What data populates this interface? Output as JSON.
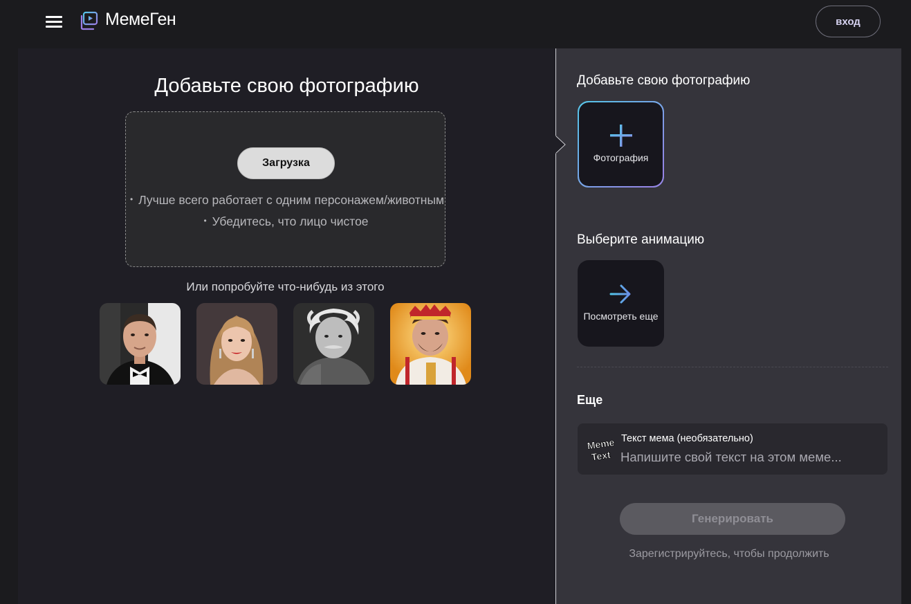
{
  "header": {
    "logo_text": "МемеГен",
    "login_label": "вход"
  },
  "main": {
    "title": "Добавьте свою фотографию",
    "upload_label": "Загрузка",
    "tips": [
      "Лучше всего работает с одним персонажем/животным",
      "Убедитесь, что лицо чистое"
    ],
    "try_label": "Или попробуйте что-нибудь из этого",
    "samples": [
      {
        "name": "sample-man-tuxedo"
      },
      {
        "name": "sample-woman-blonde"
      },
      {
        "name": "sample-old-man-bw"
      },
      {
        "name": "sample-saint-icon"
      }
    ]
  },
  "panel": {
    "photo_section_title": "Добавьте свою фотографию",
    "photo_tile_label": "Фотография",
    "animation_section_title": "Выберите анимацию",
    "animation_tile_label": "Посмотреть еще",
    "more_title": "Еще",
    "meme_text_label": "Текст мема (необязательно)",
    "meme_text_placeholder": "Напишите свой текст на этом меме...",
    "meme_icon_text_1": "Meme",
    "meme_icon_text_2": "Text",
    "generate_label": "Генерировать",
    "signup_hint": "Зарегистрируйтесь, чтобы продолжить"
  },
  "colors": {
    "accent_cyan": "#53c6e9",
    "accent_purple": "#9b7ee6",
    "panel_bg": "#35343b",
    "main_bg": "#1f1e25"
  }
}
